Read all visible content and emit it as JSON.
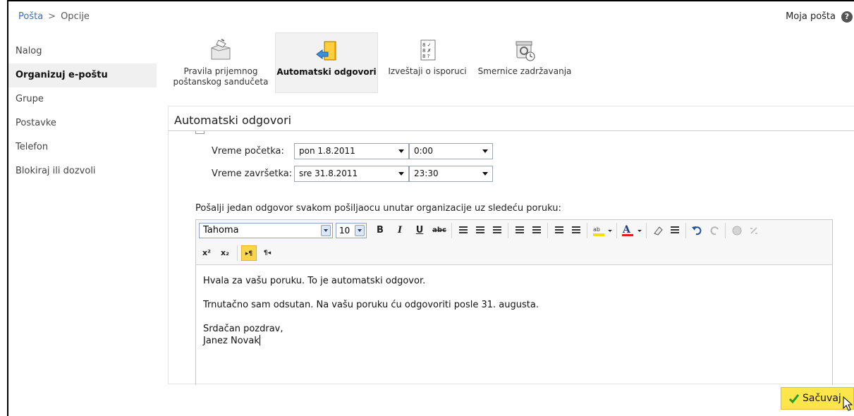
{
  "header": {
    "breadcrumb_root": "Pošta",
    "breadcrumb_sep": ">",
    "breadcrumb_current": "Opcije",
    "my_mail": "Moja pošta",
    "help_glyph": "?"
  },
  "sidebar": {
    "items": [
      {
        "label": "Nalog"
      },
      {
        "label": "Organizuj e-poštu"
      },
      {
        "label": "Grupe"
      },
      {
        "label": "Postavke"
      },
      {
        "label": "Telefon"
      },
      {
        "label": "Blokiraj ili dozvoli"
      }
    ]
  },
  "ribbon": {
    "inbox_rules_line1": "Pravila prijemnog",
    "inbox_rules_line2": "poštanskog sandučeta",
    "auto_replies": "Automatski odgovori",
    "delivery_reports": "Izveštaji o isporuci",
    "retention_policies": "Smernice zadržavanja"
  },
  "panel": {
    "title": "Automatski odgovori",
    "start_label": "Vreme početka:",
    "start_date": "pon 1.8.2011",
    "start_time": "0:00",
    "end_label": "Vreme završetka:",
    "end_date": "sre 31.8.2011",
    "end_time": "23:30",
    "reply_label": "Pošalji jedan odgovor svakom pošiljaocu unutar organizacije uz sledeću poruku:"
  },
  "editor": {
    "font": "Tahoma",
    "size": "10",
    "bold": "B",
    "italic": "I",
    "underline": "U",
    "strike": "abc",
    "superscript": "x²",
    "subscript": "x₂",
    "ltr": "▸¶",
    "rtl": "¶◂",
    "body": {
      "line1": "Hvala za vašu poruku. To je automatski odgovor.",
      "line2": "Trnutačno sam odsutan. Na vašu poruku ću odgovoriti posle 31. augusta.",
      "line3": "Srdačan pozdrav,",
      "line4": "Janez Novak"
    }
  },
  "actions": {
    "save": "Sačuvaj"
  },
  "colors": {
    "accent_link": "#3a6fb0",
    "save_bg": "#fde64b",
    "active_toggle": "#fbd54a"
  }
}
